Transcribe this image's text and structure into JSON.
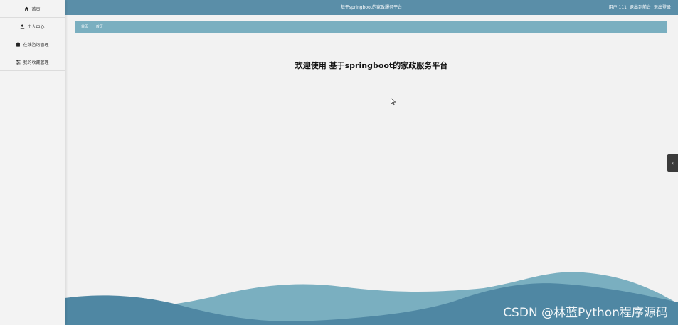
{
  "sidebar": {
    "items": [
      {
        "label": "首页",
        "icon": "home-icon"
      },
      {
        "label": "个人中心",
        "icon": "user-icon"
      },
      {
        "label": "在线咨询管理",
        "icon": "clipboard-icon"
      },
      {
        "label": "我的收藏管理",
        "icon": "sliders-icon"
      }
    ]
  },
  "header": {
    "title": "基于springboot的家政服务平台",
    "user": "用户 111",
    "back_to_front": "退出到前台",
    "logout": "退出登录"
  },
  "breadcrumb": {
    "items": [
      "首页",
      "首页"
    ],
    "separator": "⁝"
  },
  "main": {
    "welcome": "欢迎使用 基于springboot的家政服务平台"
  },
  "collapse_tab": {
    "glyph": "‹"
  },
  "watermark": "CSDN @林蓝Python程序源码",
  "colors": {
    "header": "#5a8ea8",
    "breadcrumb": "#7aafc0",
    "wave_light": "#7aafc0",
    "wave_dark": "#4f87a3",
    "background": "#f2f2f2"
  }
}
